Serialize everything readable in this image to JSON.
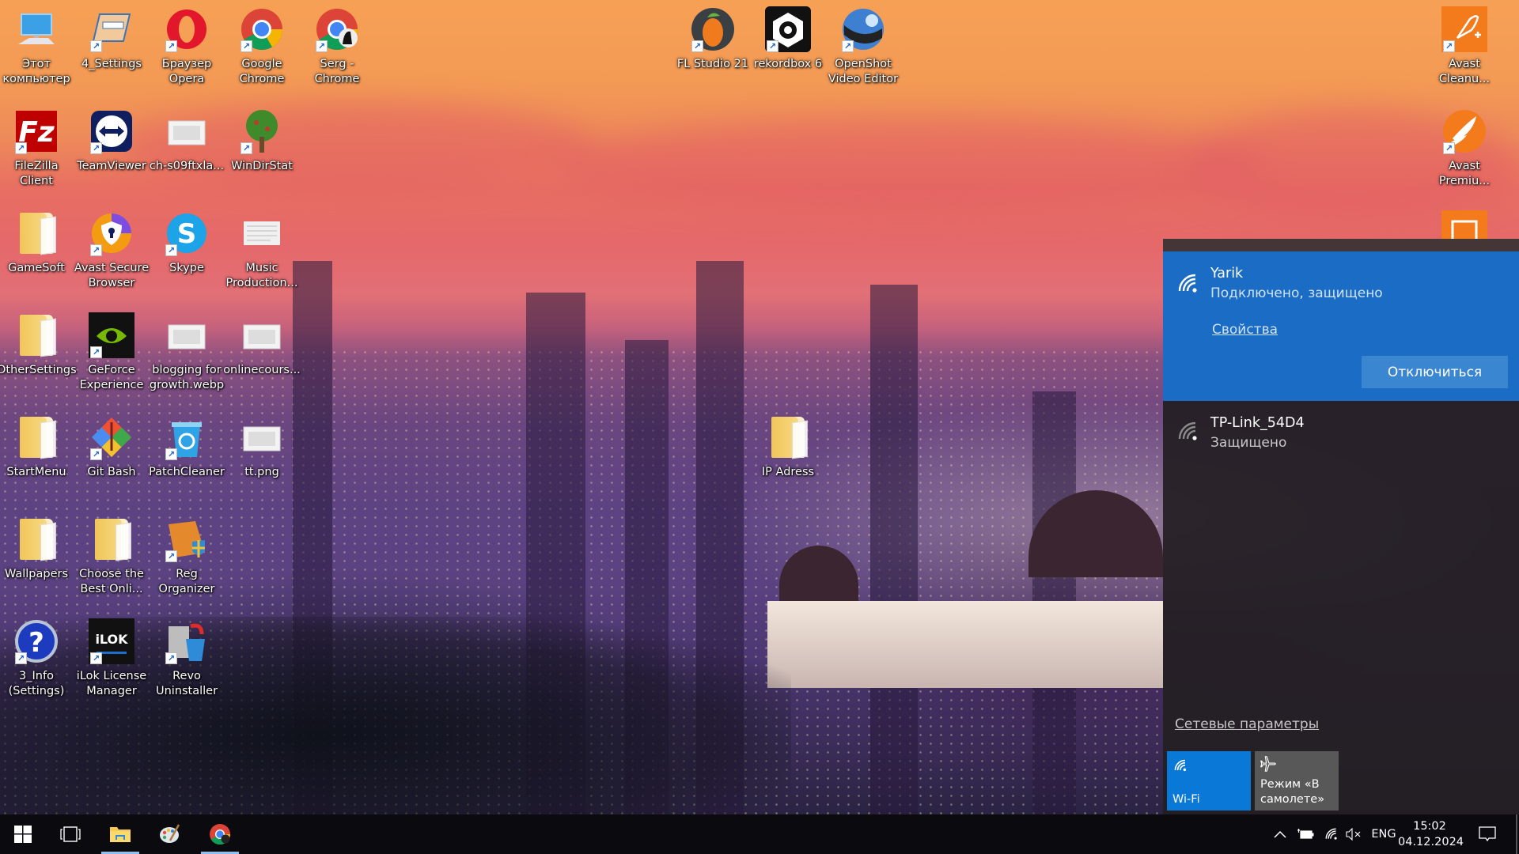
{
  "desktop": {
    "icons": [
      {
        "label": "Этот компьютер",
        "shortcut": false,
        "kind": "this-pc-icon"
      },
      {
        "label": "4_Settings",
        "shortcut": true,
        "kind": "settings-shortcut-icon"
      },
      {
        "label": "Браузер Opera",
        "shortcut": true,
        "kind": "opera-icon"
      },
      {
        "label": "Google Chrome",
        "shortcut": true,
        "kind": "chrome-icon"
      },
      {
        "label": "Serg - Chrome",
        "shortcut": true,
        "kind": "chrome-profile-icon"
      },
      {
        "label": "FileZilla Client",
        "shortcut": true,
        "kind": "filezilla-icon"
      },
      {
        "label": "TeamViewer",
        "shortcut": true,
        "kind": "teamviewer-icon"
      },
      {
        "label": "ch-s09ftxla...",
        "shortcut": false,
        "kind": "image-file-icon"
      },
      {
        "label": "WinDirStat",
        "shortcut": true,
        "kind": "windirstat-icon"
      },
      {
        "label": "GameSoft",
        "shortcut": false,
        "kind": "folder-icon"
      },
      {
        "label": "Avast Secure Browser",
        "shortcut": true,
        "kind": "avast-browser-icon"
      },
      {
        "label": "Skype",
        "shortcut": true,
        "kind": "skype-icon"
      },
      {
        "label": "Music Production...",
        "shortcut": false,
        "kind": "document-icon"
      },
      {
        "label": "OtherSettings",
        "shortcut": false,
        "kind": "folder-icon"
      },
      {
        "label": "GeForce Experience",
        "shortcut": true,
        "kind": "nvidia-icon"
      },
      {
        "label": "blogging for growth.webp",
        "shortcut": false,
        "kind": "image-file-icon"
      },
      {
        "label": "onlinecours...",
        "shortcut": false,
        "kind": "image-file-icon"
      },
      {
        "label": "StartMenu",
        "shortcut": false,
        "kind": "folder-icon"
      },
      {
        "label": "Git Bash",
        "shortcut": true,
        "kind": "git-bash-icon"
      },
      {
        "label": "PatchCleaner",
        "shortcut": true,
        "kind": "recycle-bin-icon"
      },
      {
        "label": "tt.png",
        "shortcut": false,
        "kind": "image-file-icon"
      },
      {
        "label": "Wallpapers",
        "shortcut": false,
        "kind": "folder-icon"
      },
      {
        "label": "Choose the Best Onli...",
        "shortcut": false,
        "kind": "folder-icon"
      },
      {
        "label": "Reg Organizer",
        "shortcut": true,
        "kind": "reg-organizer-icon"
      },
      {
        "label": "3_Info (Settings)",
        "shortcut": true,
        "kind": "help-icon"
      },
      {
        "label": "iLok License Manager",
        "shortcut": true,
        "kind": "ilok-icon"
      },
      {
        "label": "Revo Uninstaller",
        "shortcut": true,
        "kind": "revo-uninstaller-icon"
      },
      {
        "label": "FL Studio 21",
        "shortcut": true,
        "kind": "fl-studio-icon"
      },
      {
        "label": "rekordbox 6",
        "shortcut": true,
        "kind": "rekordbox-icon"
      },
      {
        "label": "OpenShot Video Editor",
        "shortcut": true,
        "kind": "openshot-icon"
      },
      {
        "label": "IP Adress",
        "shortcut": false,
        "kind": "folder-icon"
      },
      {
        "label": "Avast Cleanu...",
        "shortcut": true,
        "kind": "avast-cleanup-icon"
      },
      {
        "label": "Avast Premiu...",
        "shortcut": true,
        "kind": "avast-premium-icon"
      },
      {
        "label": "",
        "shortcut": false,
        "kind": "avast-driver-updater-icon"
      }
    ]
  },
  "network_flyout": {
    "connected": {
      "ssid": "Yarik",
      "status": "Подключено, защищено",
      "properties_link": "Свойства",
      "disconnect_button": "Отключиться"
    },
    "available": [
      {
        "ssid": "TP-Link_54D4",
        "status": "Защищено"
      }
    ],
    "settings_link": "Сетевые параметры",
    "quick_actions": [
      {
        "label": "Wi-Fi",
        "active": true
      },
      {
        "label": "Режим «В самолете»",
        "active": false
      }
    ],
    "accent_color": "#1a6cc4"
  },
  "taskbar": {
    "pinned": [
      "Start",
      "Task View",
      "File Explorer",
      "Paint",
      "Google Chrome"
    ],
    "tray": {
      "language": "ENG",
      "time": "15:02",
      "date": "04.12.2024"
    }
  }
}
